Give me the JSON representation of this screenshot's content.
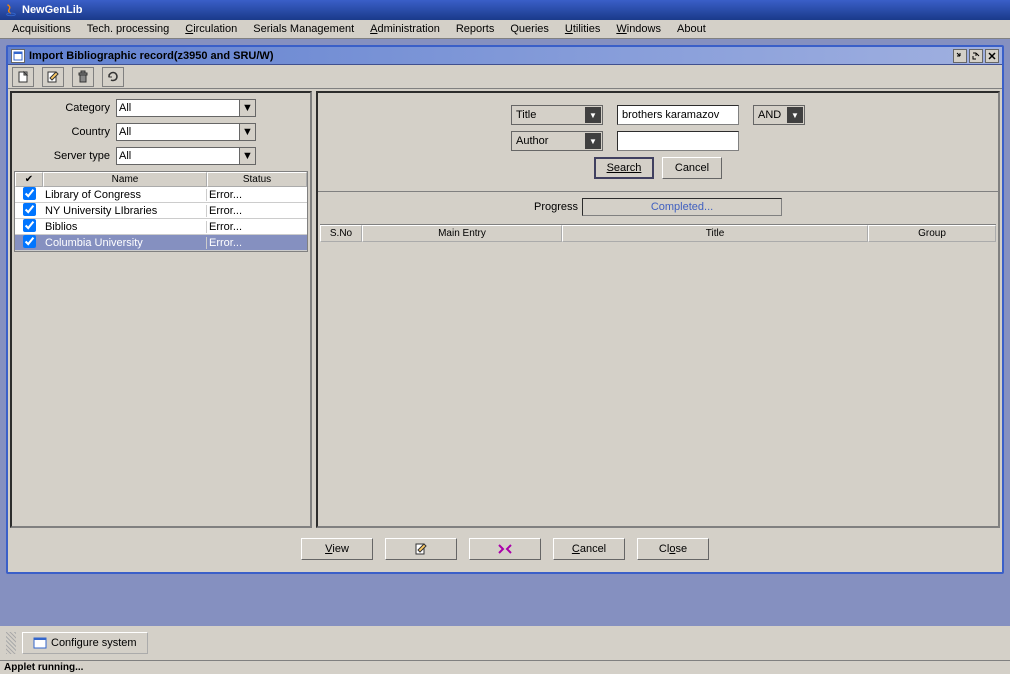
{
  "app": {
    "title": "NewGenLib"
  },
  "menubar": {
    "acquisitions": "Acquisitions",
    "tech": "Tech. processing",
    "circulation": "Circulation",
    "serials": "Serials Management",
    "admin": "Administration",
    "reports": "Reports",
    "queries": "Queries",
    "utilities": "Utilities",
    "windows": "Windows",
    "about": "About"
  },
  "window": {
    "title": "Import Bibliographic record(z3950 and SRU/W)"
  },
  "filters": {
    "category_label": "Category",
    "category_value": "All",
    "country_label": "Country",
    "country_value": "All",
    "servertype_label": "Server type",
    "servertype_value": "All"
  },
  "server_table": {
    "headers": {
      "check": "✔",
      "name": "Name",
      "status": "Status"
    },
    "rows": [
      {
        "checked": true,
        "name": "Library of Congress",
        "status": "Error...",
        "selected": false
      },
      {
        "checked": true,
        "name": "NY University LIbraries",
        "status": "Error...",
        "selected": false
      },
      {
        "checked": true,
        "name": "Biblios",
        "status": "Error...",
        "selected": false
      },
      {
        "checked": true,
        "name": "Columbia University",
        "status": "Error...",
        "selected": true
      }
    ]
  },
  "search": {
    "field1_type": "Title",
    "field1_value": "brothers karamazov",
    "op1": "AND",
    "field2_type": "Author",
    "field2_value": "",
    "search_btn": "Search",
    "cancel_btn": "Cancel"
  },
  "progress": {
    "label": "Progress",
    "status": "Completed..."
  },
  "results": {
    "headers": {
      "sno": "S.No",
      "main": "Main Entry",
      "title": "Title",
      "group": "Group"
    }
  },
  "buttons": {
    "view": "View",
    "cancel": "Cancel",
    "close": "Close"
  },
  "taskbar": {
    "configure": "Configure system"
  },
  "statusbar": {
    "text": "Applet running..."
  }
}
